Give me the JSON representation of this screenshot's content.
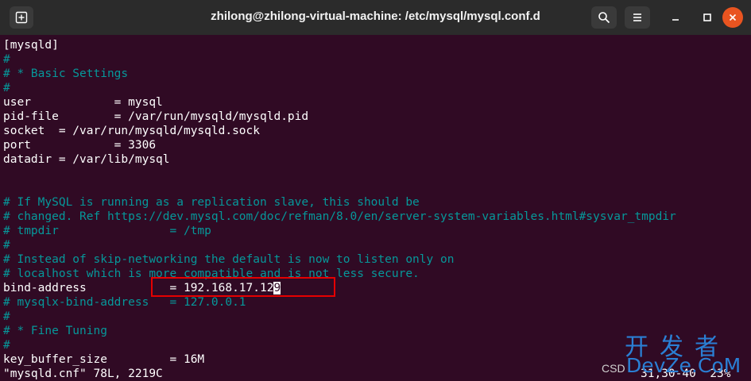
{
  "window": {
    "title": "zhilong@zhilong-virtual-machine: /etc/mysql/mysql.conf.d"
  },
  "terminal": {
    "lines": [
      "[mysqld]",
      "#",
      "# * Basic Settings",
      "#",
      "user            = mysql",
      "pid-file        = /var/run/mysqld/mysqld.pid",
      "socket  = /var/run/mysqld/mysqld.sock",
      "port            = 3306",
      "datadir = /var/lib/mysql",
      "",
      "",
      "# If MySQL is running as a replication slave, this should be",
      "# changed. Ref https://dev.mysql.com/doc/refman/8.0/en/server-system-variables.html#sysvar_tmpdir",
      "# tmpdir                = /tmp",
      "#",
      "# Instead of skip-networking the default is now to listen only on",
      "# localhost which is more compatible and is not less secure.",
      "",
      "# mysqlx-bind-address   = 127.0.0.1",
      "#",
      "# * Fine Tuning",
      "#",
      "key_buffer_size         = 16M"
    ],
    "bind_line_before_cursor": "bind-address            = 192.168.17.12",
    "cursor_char": "9",
    "status_file": "\"mysqld.cnf\" 78L, 2219C",
    "status_position": "31,30-40",
    "status_percent": "23%"
  },
  "watermark": {
    "cn": "开发者",
    "en": "DevZe.CoM",
    "csdn": "CSD"
  },
  "colors": {
    "background": "#300a24",
    "titlebar": "#2b2b2b",
    "comment": "#06989a",
    "highlight_box": "#e60000",
    "watermark": "#2a7fd4"
  }
}
